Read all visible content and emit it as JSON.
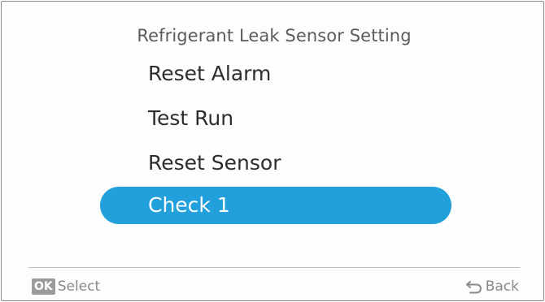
{
  "screen": {
    "title": "Refrigerant Leak Sensor Setting"
  },
  "menu": {
    "items": [
      {
        "label": "Reset Alarm"
      },
      {
        "label": "Test Run"
      },
      {
        "label": "Reset Sensor"
      },
      {
        "label": "Check 1",
        "selected": true
      }
    ]
  },
  "footer": {
    "ok_key": "OK",
    "select_label": "Select",
    "back_label": "Back",
    "back_icon": "return-arrow-icon"
  },
  "colors": {
    "highlight": "#21a0dc",
    "text": "#2d2d2d",
    "title": "#5b5b5b",
    "footer": "#8a8a8a"
  }
}
